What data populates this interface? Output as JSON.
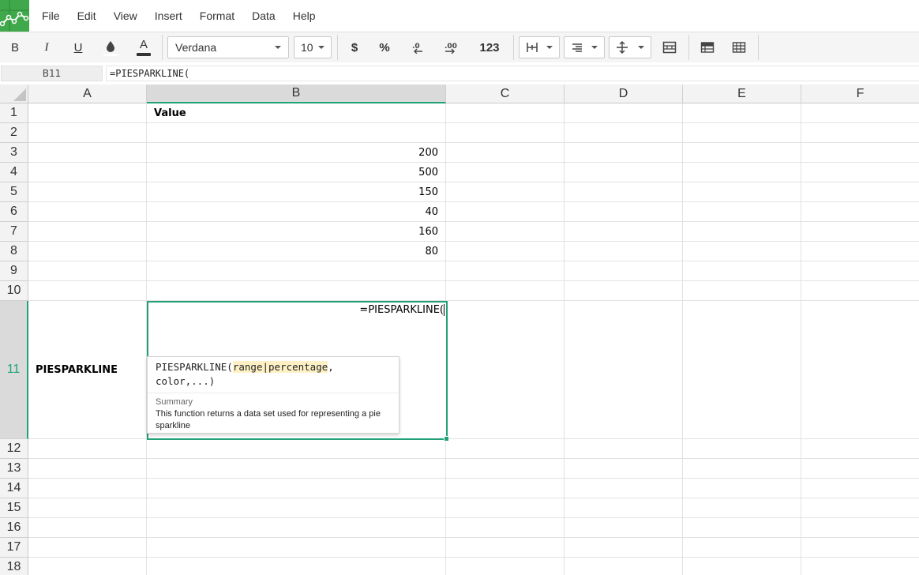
{
  "menu": [
    "File",
    "Edit",
    "View",
    "Insert",
    "Format",
    "Data",
    "Help"
  ],
  "toolbar": {
    "bold": "B",
    "italic": "I",
    "underline": "U",
    "text_color_letter": "A",
    "font": "Verdana",
    "font_size": "10",
    "currency": "$",
    "percent": "%",
    "number_format": "123"
  },
  "formula_bar": {
    "cell_ref": "B11",
    "content": "=PIESPARKLINE("
  },
  "columns": [
    "A",
    "B",
    "C",
    "D",
    "E",
    "F"
  ],
  "rows": [
    "1",
    "2",
    "3",
    "4",
    "5",
    "6",
    "7",
    "8",
    "9",
    "10",
    "11",
    "12",
    "13",
    "14",
    "15",
    "16",
    "17",
    "18"
  ],
  "cells": {
    "B1": "Value",
    "B3": "200",
    "B4": "500",
    "B5": "150",
    "B6": "40",
    "B7": "160",
    "B8": "80",
    "A11": "PIESPARKLINE"
  },
  "selected": {
    "column": "B",
    "row": "11"
  },
  "editor": {
    "text": "=PIESPARKLINE("
  },
  "tooltip": {
    "signature_start": "PIESPARKLINE(",
    "signature_arg": "range|percentage",
    "signature_comma": ",",
    "signature_rest": "color,...)",
    "summary_heading": "Summary",
    "summary_text": "This function returns a data set used for representing a pie sparkline"
  },
  "colors": {
    "accent": "#21a179",
    "logo": "#3fa84a"
  }
}
